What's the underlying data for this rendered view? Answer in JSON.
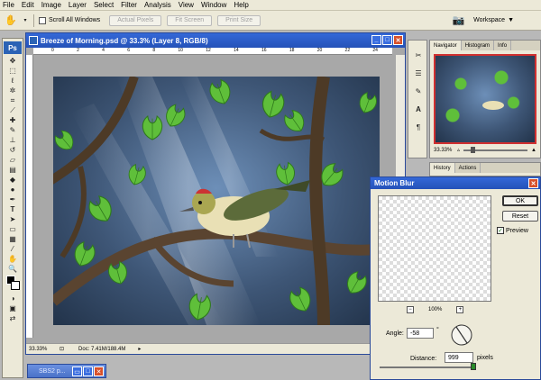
{
  "menu": [
    "File",
    "Edit",
    "Image",
    "Layer",
    "Select",
    "Filter",
    "Analysis",
    "View",
    "Window",
    "Help"
  ],
  "options": {
    "scroll_all_label": "Scroll All Windows",
    "actual_pixels": "Actual Pixels",
    "fit_screen": "Fit Screen",
    "print_size": "Print Size",
    "workspace": "Workspace"
  },
  "toolbox": {
    "logo": "Ps"
  },
  "document": {
    "title": "Breeze of Morning.psd @ 33.3% (Layer 8, RGB/8)",
    "ruler_h": [
      "0",
      "2",
      "4",
      "6",
      "8",
      "10",
      "12",
      "14",
      "16",
      "18",
      "20",
      "22",
      "24"
    ],
    "zoom": "33.33%",
    "doc_size": "Doc: 7.41M/188.4M"
  },
  "navigator": {
    "tabs": [
      "Navigator",
      "Histogram",
      "Info"
    ],
    "zoom": "33.33%"
  },
  "history": {
    "tabs": [
      "History",
      "Actions"
    ]
  },
  "motion_blur": {
    "title": "Motion Blur",
    "ok": "OK",
    "reset": "Reset",
    "preview_label": "Preview",
    "preview_zoom": "100%",
    "angle_label": "Angle:",
    "angle_value": "-58",
    "angle_unit": "°",
    "distance_label": "Distance:",
    "distance_value": "999",
    "distance_unit": "pixels"
  },
  "minimized": {
    "title": "SBS2 p..."
  }
}
